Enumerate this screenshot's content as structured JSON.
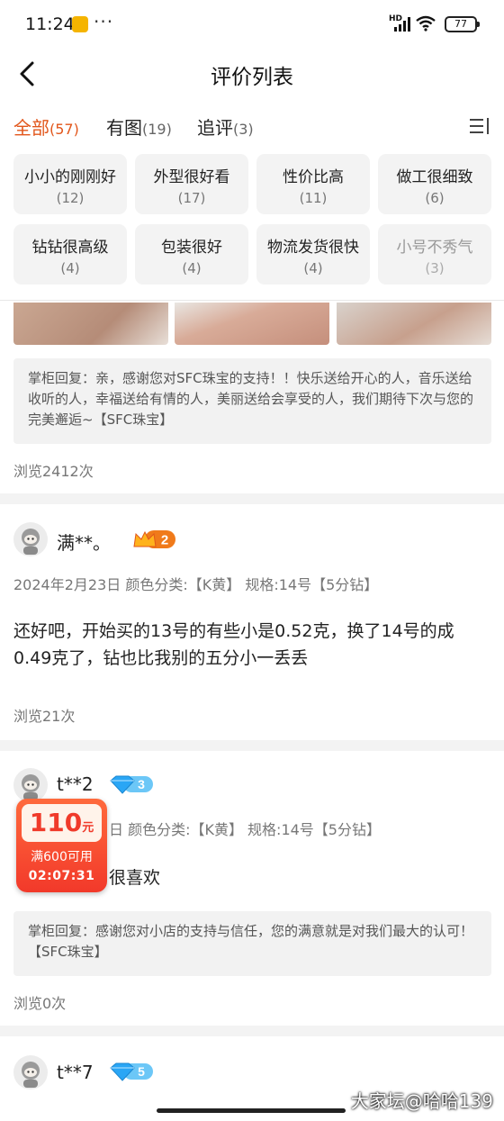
{
  "status_bar": {
    "time": "11:24",
    "more": "···",
    "hd": "HD",
    "battery": "77"
  },
  "nav": {
    "title": "评价列表"
  },
  "tabs": [
    {
      "label": "全部",
      "count": "(57)",
      "active": true
    },
    {
      "label": "有图",
      "count": "(19)",
      "active": false
    },
    {
      "label": "追评",
      "count": "(3)",
      "active": false
    }
  ],
  "tags": [
    {
      "label": "小小的刚刚好",
      "count": "(12)"
    },
    {
      "label": "外型很好看",
      "count": "(17)"
    },
    {
      "label": "性价比高",
      "count": "(11)"
    },
    {
      "label": "做工很细致",
      "count": "(6)"
    },
    {
      "label": "钻钻很高级",
      "count": "(4)"
    },
    {
      "label": "包装很好",
      "count": "(4)"
    },
    {
      "label": "物流发货很快",
      "count": "(4)"
    },
    {
      "label": "小号不秀气",
      "count": "(3)"
    }
  ],
  "review0": {
    "reply": "掌柜回复：亲，感谢您对SFC珠宝的支持！！快乐送给开心的人，音乐送给收听的人，幸福送给有情的人，美丽送给会享受的人，我们期待下次与您的完美邂逅~【SFC珠宝】",
    "views": "浏览2412次"
  },
  "review1": {
    "user": "满**。",
    "level": "2",
    "meta": "2024年2月23日 颜色分类:【K黄】 规格:14号【5分钻】",
    "content": "还好吧，开始买的13号的有些小是0.52克，换了14号的成0.49克了，钻也比我别的五分小一丢丢",
    "views": "浏览21次"
  },
  "review2": {
    "user": "t**2",
    "level": "3",
    "meta": "日 颜色分类:【K黄】 规格:14号【5分钻】",
    "content": "很喜欢",
    "reply": "掌柜回复：感谢您对小店的支持与信任，您的满意就是对我们最大的认可！【SFC珠宝】",
    "views": "浏览0次"
  },
  "review3": {
    "user": "t**7",
    "level": "5"
  },
  "coupon": {
    "amount": "110",
    "unit": "元",
    "condition": "满600可用",
    "countdown": "02:07:31"
  },
  "watermark": "大家坛@哈哈139",
  "colors": {
    "accent": "#e2561b",
    "coupon_red": "#f2392a",
    "diamond": "#2aa6f5",
    "crown": "#f07a1a"
  }
}
